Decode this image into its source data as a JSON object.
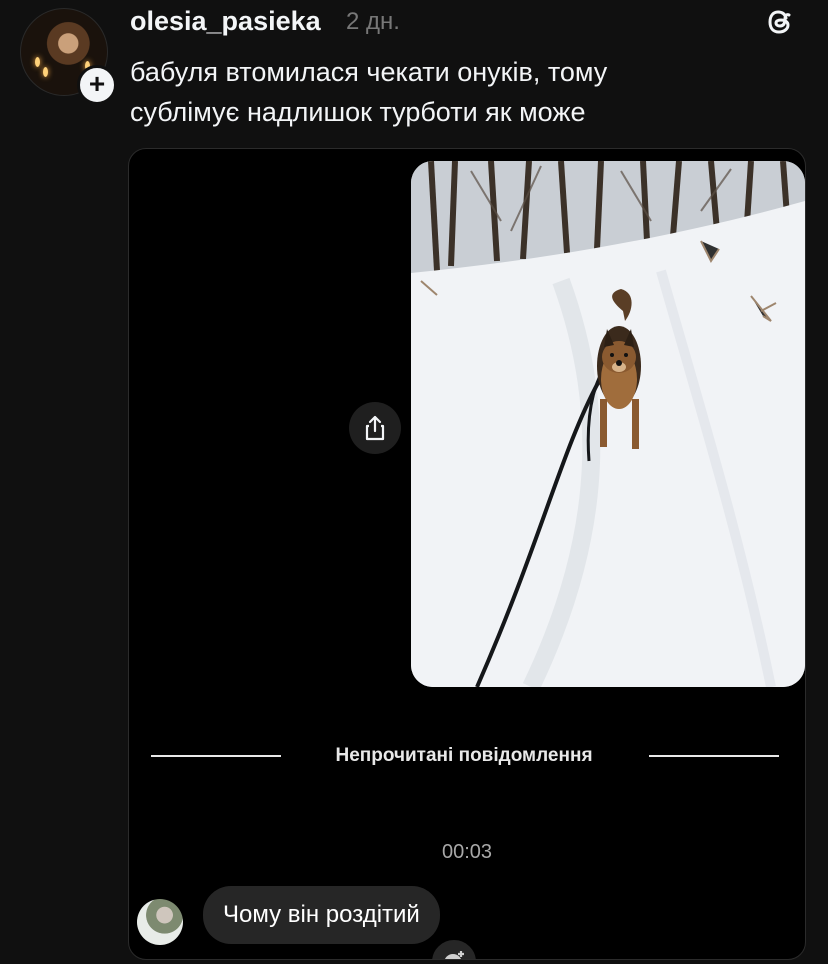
{
  "post": {
    "username": "olesia_pasieka",
    "time": "2 дн.",
    "text_lines": [
      "бабуля втомилася чекати онуків,  тому",
      "сублімує надлишок турботи як може"
    ]
  },
  "chat": {
    "divider_label": "Непрочитані повідомлення",
    "timestamp": "00:03",
    "message": "Чому він роздітий"
  },
  "icons": {
    "avatar": "profile-avatar",
    "follow": "plus-icon",
    "app": "threads-icon",
    "share": "share-icon",
    "react": "emoji-react-icon"
  },
  "colors": {
    "background": "#101010",
    "chat_background": "#000000",
    "bubble": "#262626",
    "muted": "#777777"
  }
}
